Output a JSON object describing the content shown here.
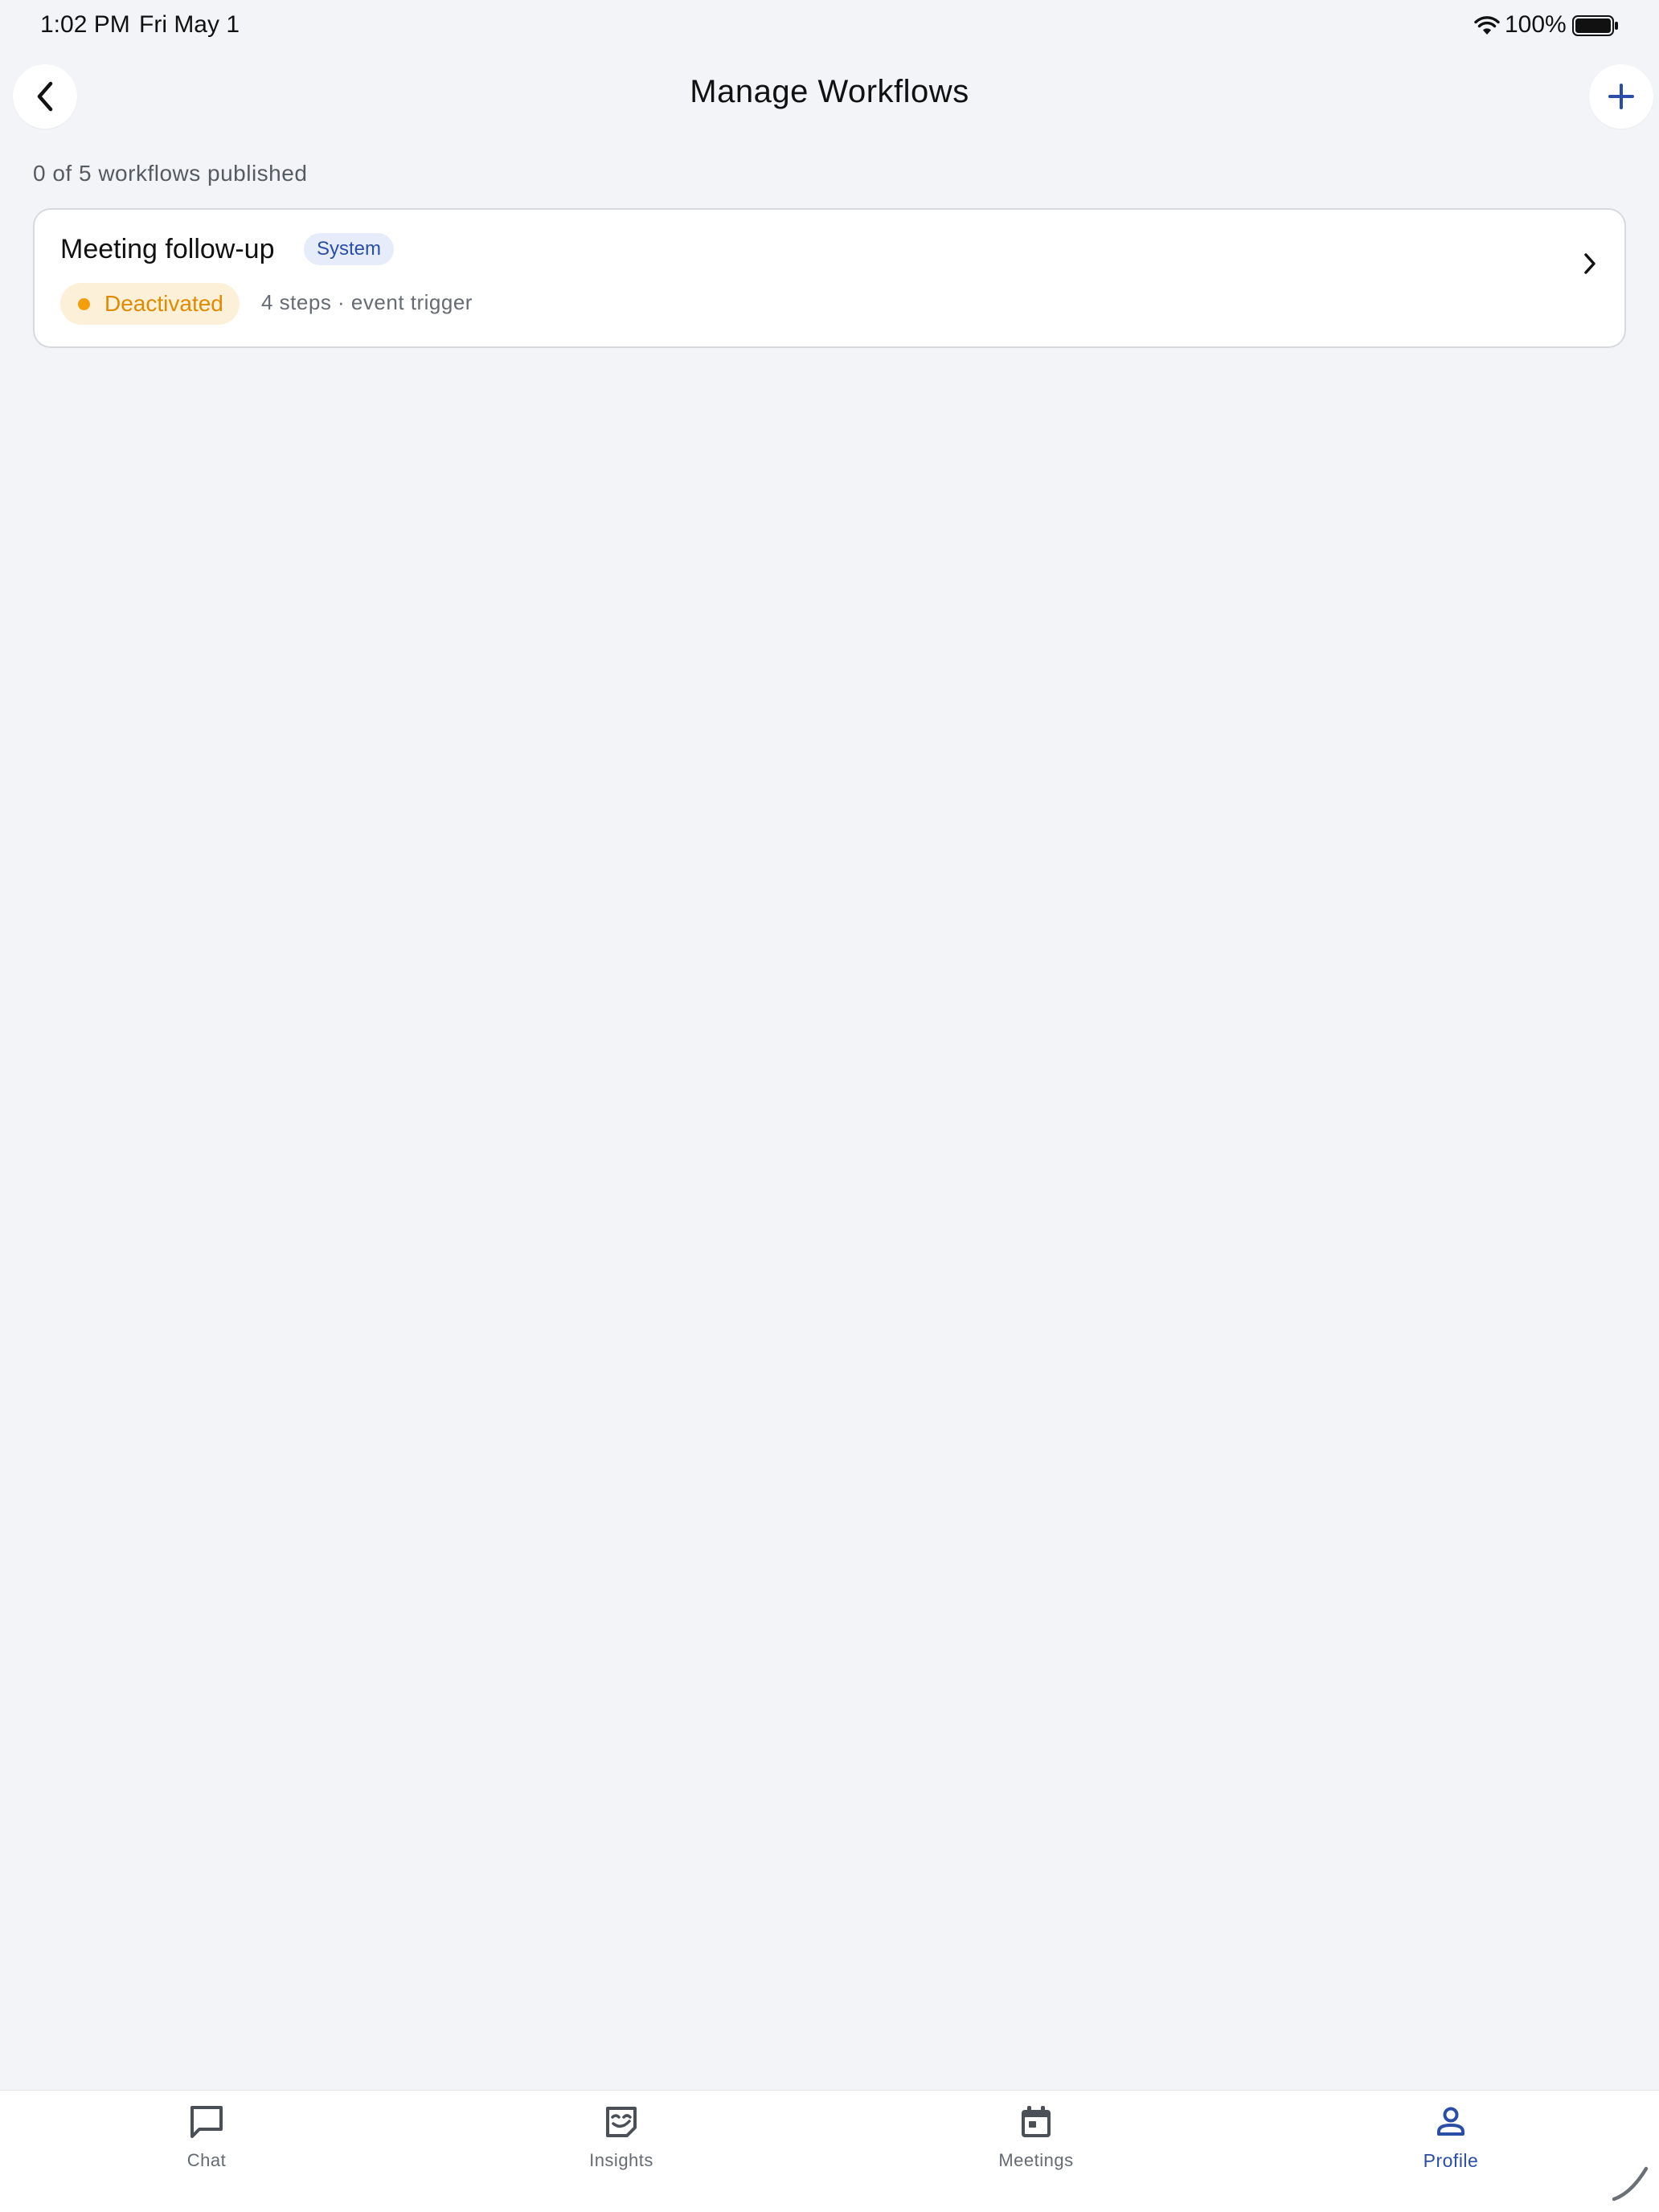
{
  "status_bar": {
    "time": "1:02 PM",
    "date": "Fri May 1",
    "battery_percent": "100%",
    "icons": [
      "wifi-icon",
      "battery-icon"
    ]
  },
  "header": {
    "title": "Manage Workflows",
    "back_icon": "chevron-left-icon",
    "add_icon": "plus-icon"
  },
  "summary": {
    "published_text": "0 of 5 workflows published"
  },
  "workflows": [
    {
      "title": "Meeting follow-up",
      "badge": "System",
      "status": "Deactivated",
      "meta": "4 steps · event trigger"
    }
  ],
  "tab_bar": {
    "tabs": [
      {
        "label": "Chat",
        "icon": "chat-icon",
        "active": false
      },
      {
        "label": "Insights",
        "icon": "insights-icon",
        "active": false
      },
      {
        "label": "Meetings",
        "icon": "calendar-icon",
        "active": false
      },
      {
        "label": "Profile",
        "icon": "profile-icon",
        "active": true
      }
    ]
  },
  "colors": {
    "background": "#f3f4f7",
    "accent": "#2a4ea8",
    "status_warning": "#f59e0b",
    "status_warning_bg": "#fdf0d9",
    "badge_bg": "#e6ecf9"
  }
}
